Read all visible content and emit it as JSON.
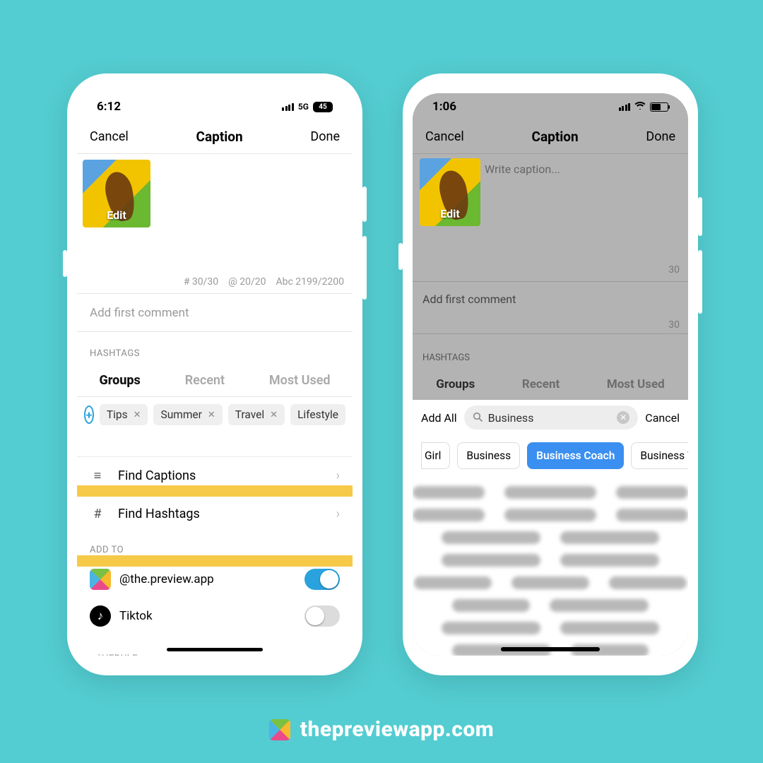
{
  "footer": {
    "text": "thepreviewapp.com"
  },
  "left": {
    "status": {
      "time": "6:12",
      "network": "5G",
      "battery_text": "45"
    },
    "nav": {
      "cancel": "Cancel",
      "title": "Caption",
      "done": "Done"
    },
    "thumb_edit": "Edit",
    "counts": {
      "hash": "# 30/30",
      "at": "@ 20/20",
      "chars": "Abc 2199/2200"
    },
    "first_comment_placeholder": "Add first comment",
    "hashtags_label": "HASHTAGS",
    "tabs": {
      "groups": "Groups",
      "recent": "Recent",
      "most": "Most Used"
    },
    "chips": [
      "Tips",
      "Summer",
      "Travel",
      "Lifestyle"
    ],
    "find_captions": "Find Captions",
    "find_hashtags": "Find Hashtags",
    "addto_label": "ADD TO",
    "addto": {
      "preview_handle": "@the.preview.app",
      "tiktok_label": "Tiktok"
    },
    "schedule_label": "SCHEDULE"
  },
  "right": {
    "status": {
      "time": "1:06"
    },
    "nav": {
      "cancel": "Cancel",
      "title": "Caption",
      "done": "Done"
    },
    "thumb_edit": "Edit",
    "caption_placeholder": "Write caption...",
    "caption_count": "30",
    "first_comment": "Add first comment",
    "first_comment_count": "30",
    "hashtags_label": "HASHTAGS",
    "tabs": {
      "groups": "Groups",
      "recent": "Recent",
      "most": "Most Used"
    },
    "search": {
      "addall": "Add All",
      "value": "Business",
      "cancel": "Cancel"
    },
    "suggestions": {
      "partial": "Girl",
      "s1": "Business",
      "s2": "Business Coach",
      "s3": "Business Woman"
    }
  }
}
